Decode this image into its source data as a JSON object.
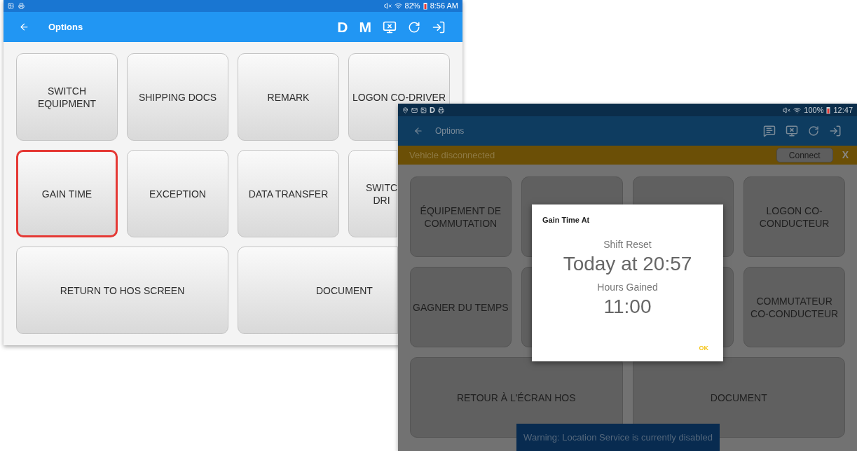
{
  "left_screen": {
    "status_bar": {
      "battery": "82%",
      "time": "8:56 AM"
    },
    "toolbar": {
      "title": "Options",
      "letter_buttons": [
        "D",
        "M"
      ]
    },
    "buttons": [
      {
        "label": "SWITCH\nEQUIPMENT",
        "wide": false,
        "selected": false
      },
      {
        "label": "SHIPPING DOCS",
        "wide": false,
        "selected": false
      },
      {
        "label": "REMARK",
        "wide": false,
        "selected": false
      },
      {
        "label": "LOGON CO-DRIVER",
        "wide": false,
        "selected": false
      },
      {
        "label": "GAIN TIME",
        "wide": false,
        "selected": true
      },
      {
        "label": "EXCEPTION",
        "wide": false,
        "selected": false
      },
      {
        "label": "DATA TRANSFER",
        "wide": false,
        "selected": false
      },
      {
        "label": "SWITC\nDRI",
        "wide": false,
        "selected": false,
        "kind": "cut"
      },
      {
        "label": "RETURN TO HOS SCREEN",
        "wide": true,
        "selected": false
      },
      {
        "label": "DOCUMENT",
        "wide": true,
        "selected": false,
        "kind": "cut"
      }
    ]
  },
  "right_screen": {
    "status_bar": {
      "indicator": "D",
      "battery": "100%",
      "time": "12:47"
    },
    "toolbar": {
      "title": "Options"
    },
    "banner": {
      "message": "Vehicle disconnected",
      "button": "Connect",
      "close": "X"
    },
    "buttons": [
      {
        "label": "ÉQUIPEMENT DE\nCOMMUTATION",
        "wide": false
      },
      {
        "wide": false
      },
      {
        "wide": false
      },
      {
        "label": "LOGON CO-\nCONDUCTEUR",
        "wide": false
      },
      {
        "label": "GAGNER DU TEMPS",
        "wide": false
      },
      {
        "wide": false
      },
      {
        "wide": false
      },
      {
        "label": "COMMUTATEUR\nCO-CONDUCTEUR",
        "wide": false
      },
      {
        "label": "RETOUR À L'ÉCRAN HOS",
        "wide": true
      },
      {
        "label": "DOCUMENT",
        "wide": true
      }
    ],
    "dialog": {
      "title": "Gain Time At",
      "label_1": "Shift Reset",
      "value_1": "Today at 20:57",
      "label_2": "Hours Gained",
      "value_2": "11:00",
      "button": "OK"
    },
    "toast": "Warning: Location Service is currently disabled"
  }
}
